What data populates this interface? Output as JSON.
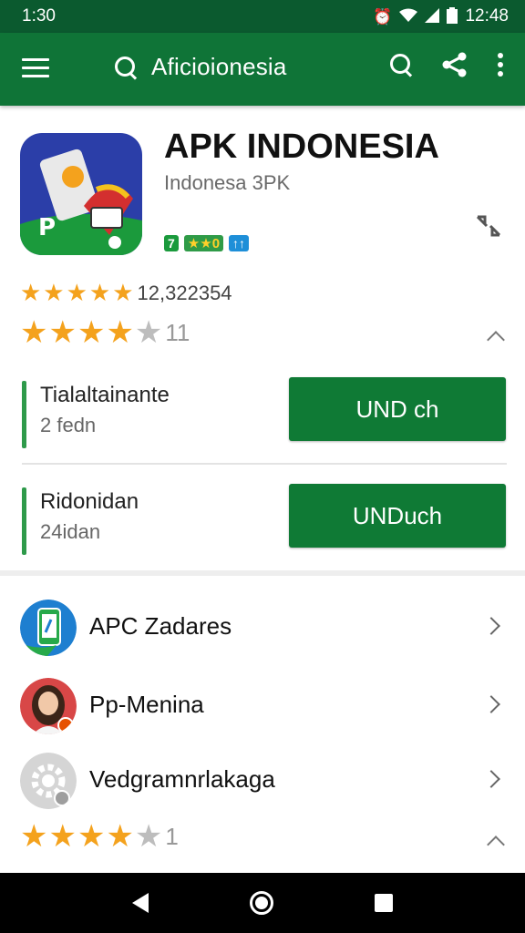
{
  "status_bar": {
    "time": "1:30",
    "clock": "12:48",
    "icons": [
      "alarm-icon",
      "wifi-icon",
      "signal-icon",
      "battery-icon"
    ]
  },
  "app_bar": {
    "title": "Aficioionesia",
    "icons": [
      "menu-icon",
      "search-icon",
      "share-icon",
      "more-icon"
    ],
    "color": "#0f7437"
  },
  "app": {
    "name": "APK INDONESIA",
    "developer": "Indonesa 3PK",
    "badge_green": "7",
    "badge_stars": "★★0",
    "badge_blue": "↑↑"
  },
  "ratings": {
    "count_text": "12,322354",
    "row1_stars": "★★★★★",
    "row2_number": "11",
    "row3_number": "1",
    "row2_filled": 4,
    "row3_filled": 4
  },
  "downloads": [
    {
      "title": "Tialaltainante",
      "subtitle": "2 fedn",
      "button": "UND ch"
    },
    {
      "title": "Ridonidan",
      "subtitle": "24idan",
      "button": "UNDuch"
    }
  ],
  "list": [
    {
      "label": "APC Zadares",
      "icon": "app-phone-icon"
    },
    {
      "label": "Pp-Menina",
      "icon": "user-avatar-icon"
    },
    {
      "label": "Vedgramnrlakaga",
      "icon": "gear-icon"
    }
  ],
  "colors": {
    "primary": "#0f7437",
    "status_bar": "#0b5a2f",
    "button": "#0f7a35",
    "star": "#f4a21d"
  }
}
